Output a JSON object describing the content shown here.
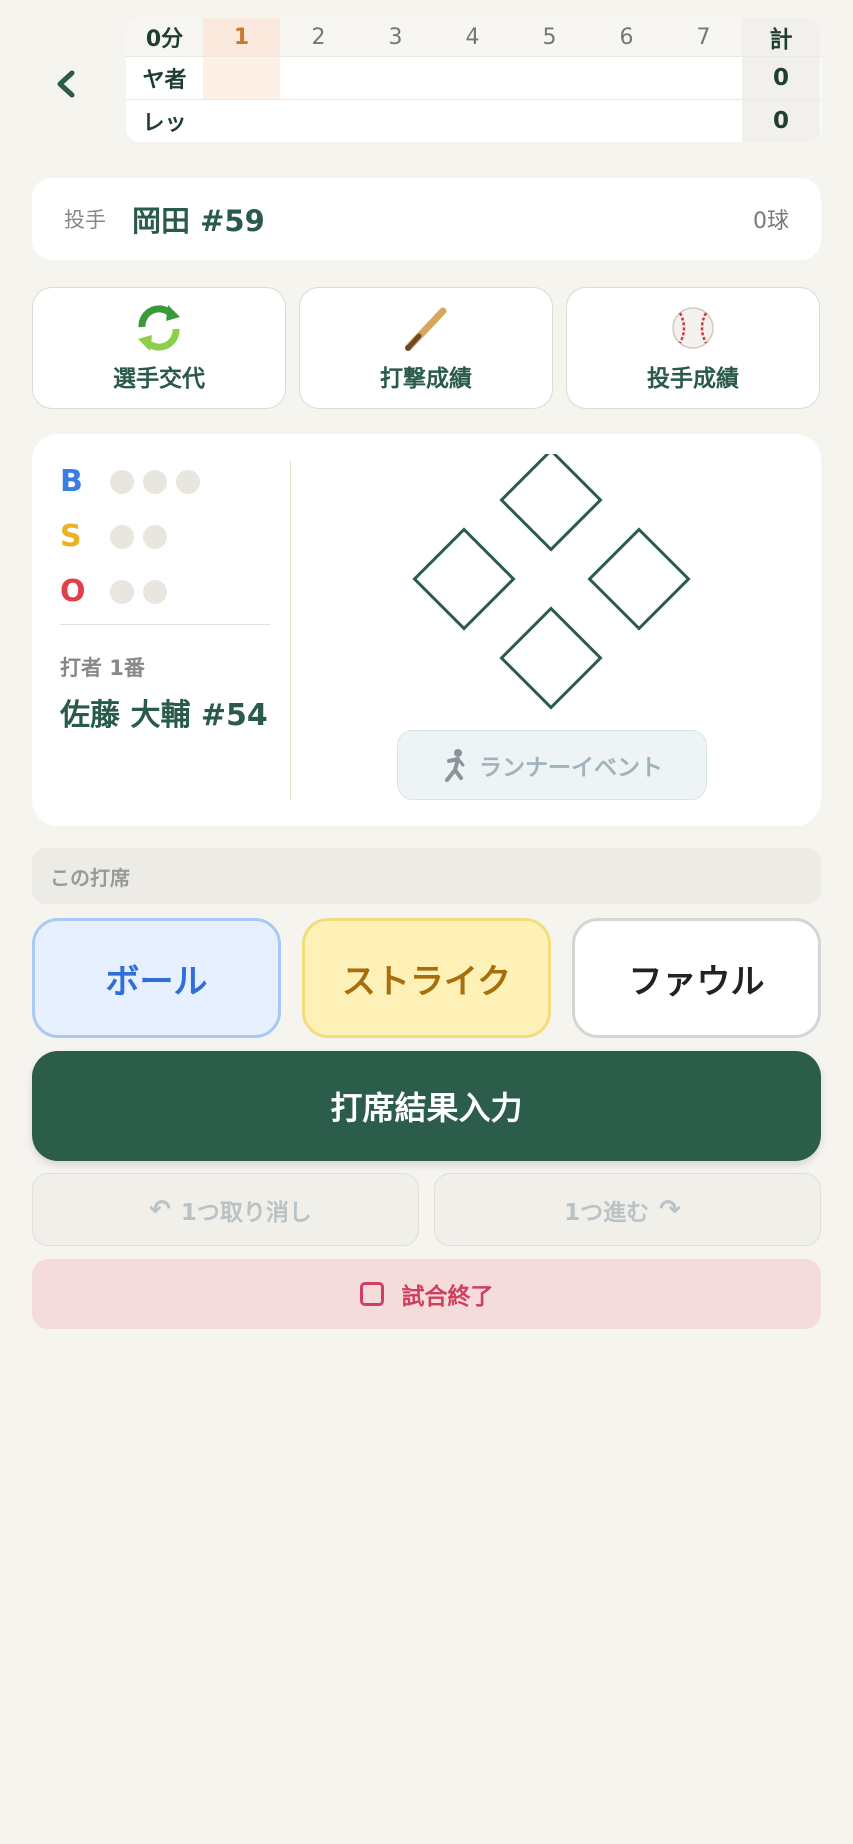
{
  "scoreboard": {
    "header_label": "0分",
    "innings": [
      "1",
      "2",
      "3",
      "4",
      "5",
      "6",
      "7"
    ],
    "current_inning": "1",
    "total_label": "計",
    "teams": [
      {
        "name": "ヤ者",
        "total": "0"
      },
      {
        "name": "レッ",
        "total": "0"
      }
    ]
  },
  "pitcher": {
    "label": "投手",
    "name": "岡田 #59",
    "pitch_count": "0球"
  },
  "actions": [
    {
      "label": "選手交代",
      "icon": "swap-icon"
    },
    {
      "label": "打撃成績",
      "icon": "bat-icon"
    },
    {
      "label": "投手成績",
      "icon": "baseball-icon"
    }
  ],
  "count": {
    "ball_letter": "B",
    "strike_letter": "S",
    "out_letter": "O",
    "colors": {
      "ball": "#3b7de0",
      "strike": "#e8b322",
      "out": "#e0404b"
    }
  },
  "batter": {
    "order": "打者 1番",
    "name": "佐藤 大輔 #54"
  },
  "runner_event": {
    "label": "ランナーイベント"
  },
  "atbat": {
    "label": "この打席"
  },
  "pitch_buttons": {
    "ball": "ボール",
    "strike": "ストライク",
    "foul": "ファウル"
  },
  "result_button": "打席結果入力",
  "undo": {
    "label": "1つ取り消し"
  },
  "redo": {
    "label": "1つ進む"
  },
  "end_game": {
    "label": "試合終了"
  },
  "colors": {
    "primary": "#2c5d4b",
    "background": "#f6f4ef"
  }
}
